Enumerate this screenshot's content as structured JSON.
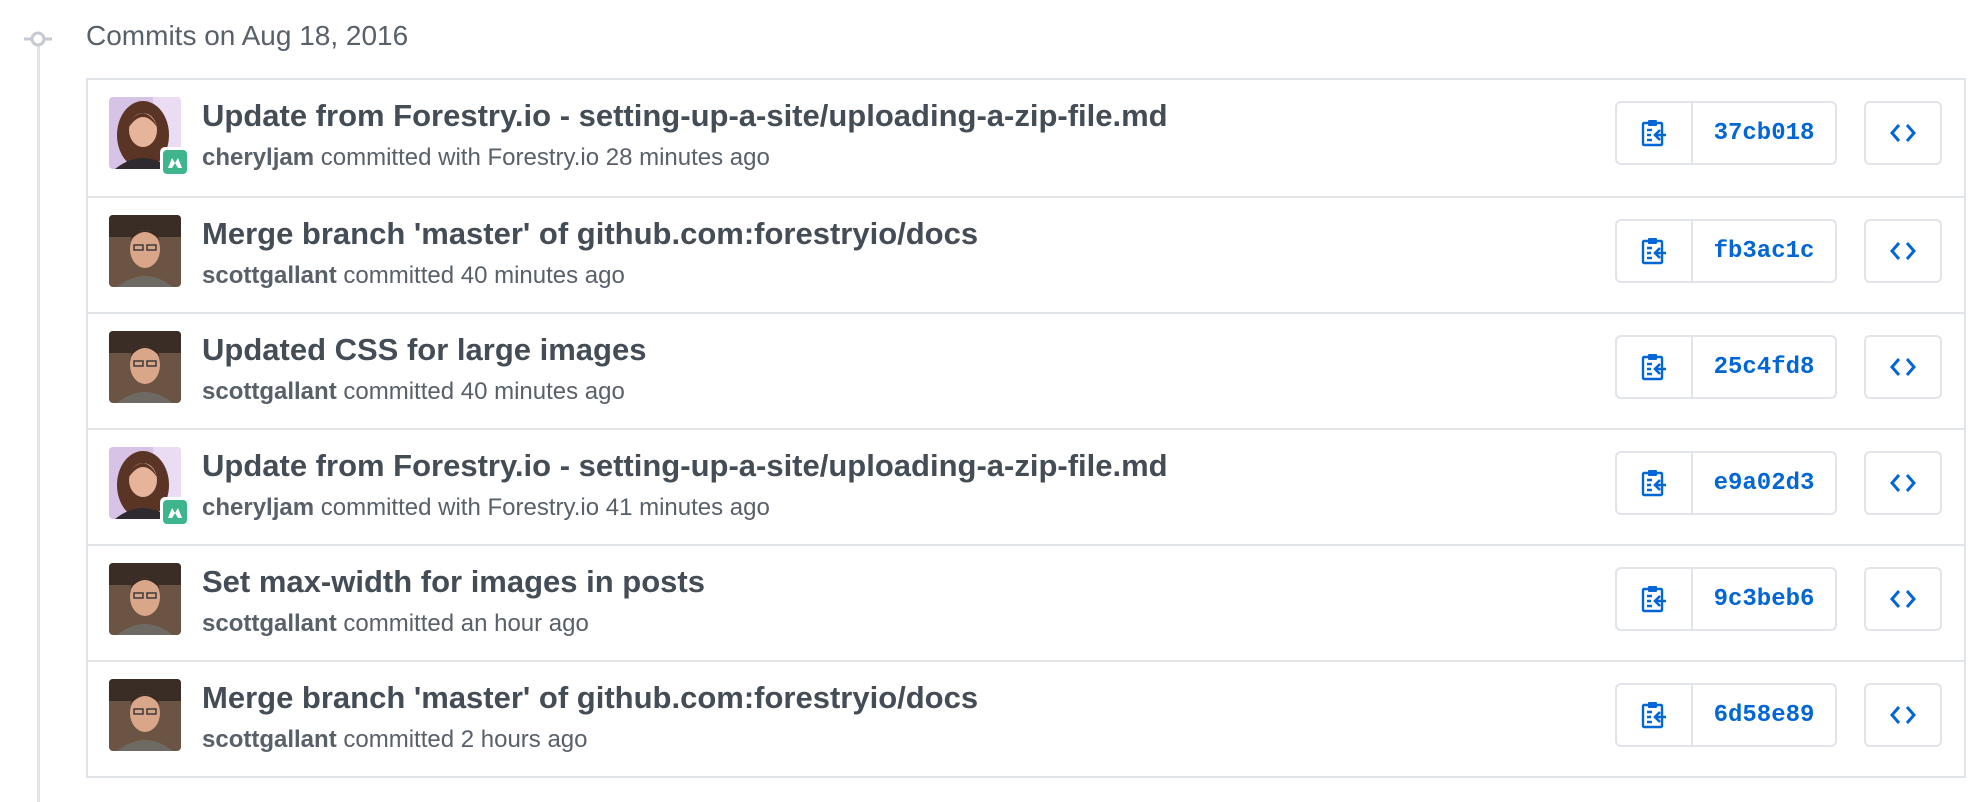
{
  "group": {
    "title": "Commits on Aug 18, 2016"
  },
  "colors": {
    "link": "#0366d6",
    "badge": "#3eb58c",
    "border": "#e1e4e8",
    "muted": "#586069"
  },
  "commits": [
    {
      "title": "Update from Forestry.io - setting-up-a-site/uploading-a-zip-file.md",
      "author": "cheryljam",
      "action": " committed",
      "with_text": " with Forestry.io",
      "time": " 28 minutes ago",
      "sha": "37cb018",
      "avatar": "cheryl",
      "badge": true
    },
    {
      "title": "Merge branch 'master' of github.com:forestryio/docs",
      "author": "scottgallant",
      "action": " committed",
      "with_text": "",
      "time": " 40 minutes ago",
      "sha": "fb3ac1c",
      "avatar": "scott",
      "badge": false
    },
    {
      "title": "Updated CSS for large images",
      "author": "scottgallant",
      "action": " committed",
      "with_text": "",
      "time": " 40 minutes ago",
      "sha": "25c4fd8",
      "avatar": "scott",
      "badge": false
    },
    {
      "title": "Update from Forestry.io - setting-up-a-site/uploading-a-zip-file.md",
      "author": "cheryljam",
      "action": " committed",
      "with_text": " with Forestry.io",
      "time": " 41 minutes ago",
      "sha": "e9a02d3",
      "avatar": "cheryl",
      "badge": true
    },
    {
      "title": "Set max-width for images in posts",
      "author": "scottgallant",
      "action": " committed",
      "with_text": "",
      "time": " an hour ago",
      "sha": "9c3beb6",
      "avatar": "scott",
      "badge": false
    },
    {
      "title": "Merge branch 'master' of github.com:forestryio/docs",
      "author": "scottgallant",
      "action": " committed",
      "with_text": "",
      "time": " 2 hours ago",
      "sha": "6d58e89",
      "avatar": "scott",
      "badge": false
    }
  ]
}
